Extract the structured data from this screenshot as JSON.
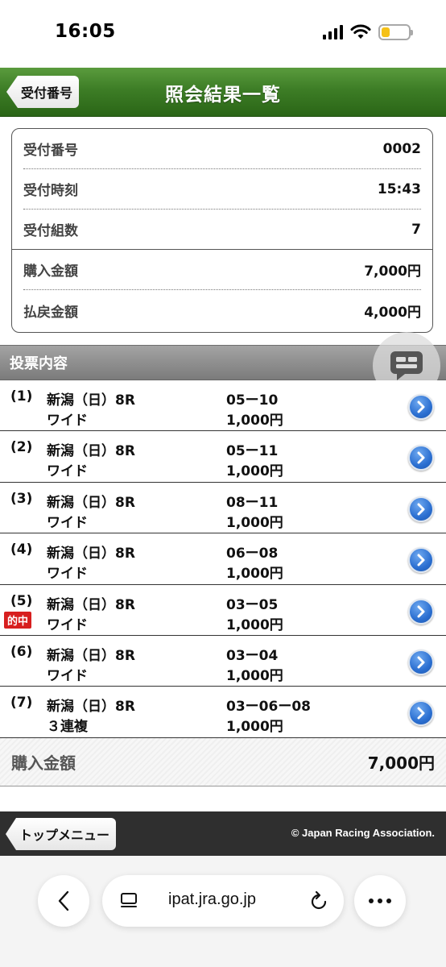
{
  "status": {
    "time": "16:05",
    "battery_level": 0.3
  },
  "header": {
    "back_label": "受付番号",
    "title": "照会結果一覧"
  },
  "summary": [
    {
      "label": "受付番号",
      "value": "0002"
    },
    {
      "label": "受付時刻",
      "value": "15:43"
    },
    {
      "label": "受付組数",
      "value": "7"
    },
    {
      "label": "購入金額",
      "value": "7,000円"
    },
    {
      "label": "払戻金額",
      "value": "4,000円"
    }
  ],
  "section": {
    "title": "投票内容"
  },
  "bets": [
    {
      "num": "(1)",
      "venue": "新潟（日）8R",
      "type": "ワイド",
      "combo": "05ー10",
      "amount": "1,000円",
      "hit": ""
    },
    {
      "num": "(2)",
      "venue": "新潟（日）8R",
      "type": "ワイド",
      "combo": "05ー11",
      "amount": "1,000円",
      "hit": ""
    },
    {
      "num": "(3)",
      "venue": "新潟（日）8R",
      "type": "ワイド",
      "combo": "08ー11",
      "amount": "1,000円",
      "hit": ""
    },
    {
      "num": "(4)",
      "venue": "新潟（日）8R",
      "type": "ワイド",
      "combo": "06ー08",
      "amount": "1,000円",
      "hit": ""
    },
    {
      "num": "(5)",
      "venue": "新潟（日）8R",
      "type": "ワイド",
      "combo": "03ー05",
      "amount": "1,000円",
      "hit": "的中"
    },
    {
      "num": "(6)",
      "venue": "新潟（日）8R",
      "type": "ワイド",
      "combo": "03ー04",
      "amount": "1,000円",
      "hit": ""
    },
    {
      "num": "(7)",
      "venue": "新潟（日）8R",
      "type": "３連複",
      "combo": "03ー06ー08",
      "amount": "1,000円",
      "hit": ""
    }
  ],
  "total": {
    "label": "購入金額",
    "value": "7,000円"
  },
  "footer": {
    "top_menu_label": "トップメニュー",
    "copyright": "© Japan Racing Association."
  },
  "browser": {
    "url": "ipat.jra.go.jp"
  },
  "colors": {
    "header_green": "#3d7d26",
    "hit_red": "#d71f1f",
    "arrow_blue": "#2b6fd1"
  }
}
